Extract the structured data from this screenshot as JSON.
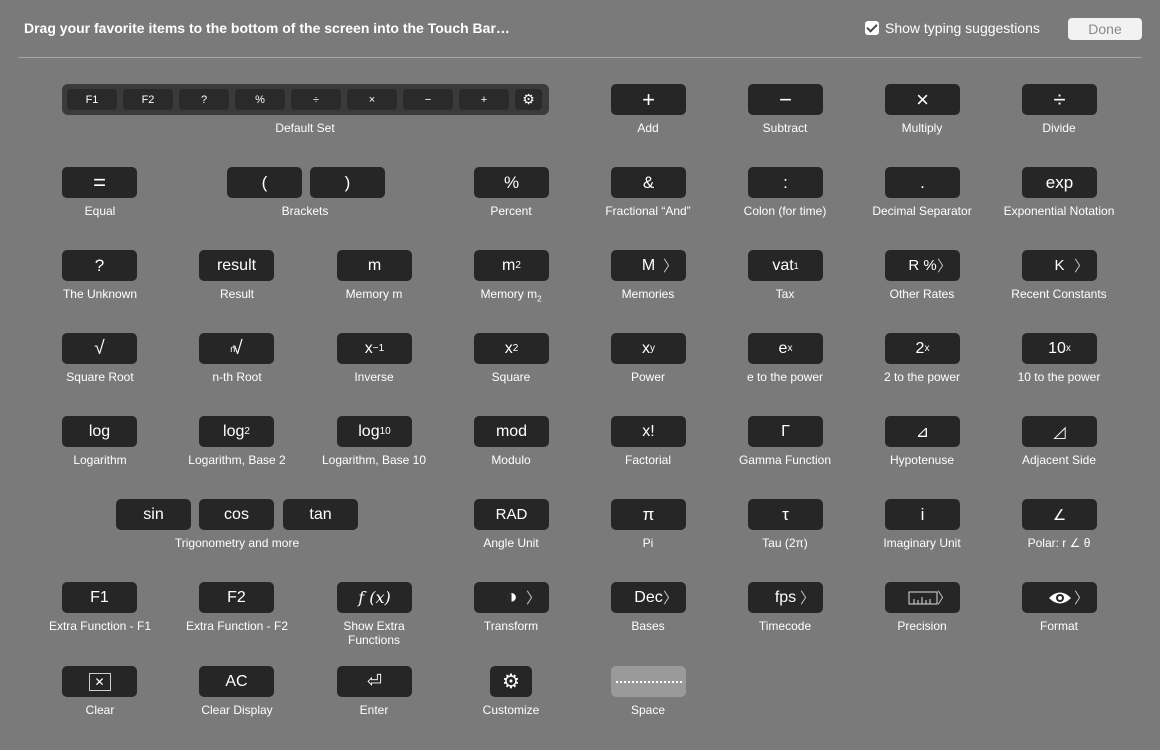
{
  "header": {
    "title": "Drag your favorite items to the bottom of the screen into the Touch Bar…",
    "suggestions_label": "Show typing suggestions",
    "suggestions_checked": true,
    "done_label": "Done"
  },
  "default_set": {
    "label": "Default Set",
    "keys": [
      "F1",
      "F2",
      "?",
      "%",
      "÷",
      "×",
      "−",
      "+",
      "⚙"
    ]
  },
  "items": {
    "add": {
      "key": "+",
      "label": "Add"
    },
    "subtract": {
      "key": "−",
      "label": "Subtract"
    },
    "multiply": {
      "key": "×",
      "label": "Multiply"
    },
    "divide": {
      "key": "÷",
      "label": "Divide"
    },
    "equal": {
      "key": "=",
      "label": "Equal"
    },
    "brackets": {
      "open": "(",
      "close": ")",
      "label": "Brackets"
    },
    "percent": {
      "key": "%",
      "label": "Percent"
    },
    "fractional_and": {
      "key": "&",
      "label": "Fractional “And”"
    },
    "colon": {
      "key": ":",
      "label": "Colon (for time)"
    },
    "decimal_separator": {
      "key": ".",
      "label": "Decimal Separator"
    },
    "exponential": {
      "key": "exp",
      "label": "Exponential Notation"
    },
    "unknown": {
      "key": "?",
      "label": "The Unknown"
    },
    "result": {
      "key": "result",
      "label": "Result"
    },
    "memory_m": {
      "key": "m",
      "label": "Memory  m"
    },
    "memory_m2": {
      "key": "m",
      "sub": "2",
      "label": "Memory  m",
      "label_sub": "2"
    },
    "memories": {
      "key": "M",
      "label": "Memories"
    },
    "tax": {
      "key": "vat",
      "sub": "1",
      "label": "Tax"
    },
    "other_rates": {
      "key": "R %",
      "label": "Other Rates"
    },
    "recent_constants": {
      "key": "K",
      "label": "Recent Constants"
    },
    "square_root": {
      "key": "√",
      "label": "Square Root"
    },
    "nth_root": {
      "key": "√",
      "sup": "n",
      "label": "n-th Root"
    },
    "inverse": {
      "key": "x",
      "sup": "−1",
      "label": "Inverse"
    },
    "square": {
      "key": "x",
      "sup": "2",
      "label": "Square"
    },
    "power": {
      "key": "x",
      "sup": "y",
      "label": "Power"
    },
    "e_power": {
      "key": "e",
      "sup": "x",
      "label": "e to the power"
    },
    "two_power": {
      "key": "2",
      "sup": "x",
      "label": "2 to the power"
    },
    "ten_power": {
      "key": "10",
      "sup": "x",
      "label": "10 to the power"
    },
    "logarithm": {
      "key": "log",
      "label": "Logarithm"
    },
    "log2": {
      "key": "log",
      "sub": "2",
      "label": "Logarithm, Base 2"
    },
    "log10": {
      "key": "log",
      "sub": "10",
      "label": "Logarithm, Base 10"
    },
    "modulo": {
      "key": "mod",
      "label": "Modulo"
    },
    "factorial": {
      "key": "x!",
      "label": "Factorial"
    },
    "gamma": {
      "key": "Γ",
      "label": "Gamma Function"
    },
    "hypotenuse": {
      "key": "⊿",
      "label": "Hypotenuse"
    },
    "adjacent": {
      "key": "◿",
      "label": "Adjacent Side"
    },
    "trig": {
      "sin": "sin",
      "cos": "cos",
      "tan": "tan",
      "label": "Trigonometry and more"
    },
    "angle_unit": {
      "key": "RAD",
      "label": "Angle Unit"
    },
    "pi": {
      "key": "π",
      "label": "Pi"
    },
    "tau": {
      "key": "τ",
      "label": "Tau (2π)"
    },
    "imaginary": {
      "key": "i",
      "label": "Imaginary Unit"
    },
    "polar": {
      "key": "∠",
      "label": "Polar: r ∠ θ"
    },
    "f1": {
      "key": "F1",
      "label": "Extra Function - F1"
    },
    "f2": {
      "key": "F2",
      "label": "Extra Function - F2"
    },
    "show_extra": {
      "key": "f (x)",
      "label": "Show Extra Functions"
    },
    "transform": {
      "key": "◑",
      "label": "Transform"
    },
    "bases": {
      "key": "Dec",
      "label": "Bases"
    },
    "timecode": {
      "key": "fps",
      "label": "Timecode"
    },
    "precision": {
      "key": "",
      "label": "Precision"
    },
    "format": {
      "key": "",
      "label": "Format"
    },
    "clear": {
      "key": "✕",
      "label": "Clear"
    },
    "clear_display": {
      "key": "AC",
      "label": "Clear Display"
    },
    "enter": {
      "key": "⏎",
      "label": "Enter"
    },
    "customize": {
      "key": "⚙",
      "label": "Customize"
    },
    "space": {
      "key": "",
      "label": "Space"
    }
  },
  "chevron": "〉"
}
